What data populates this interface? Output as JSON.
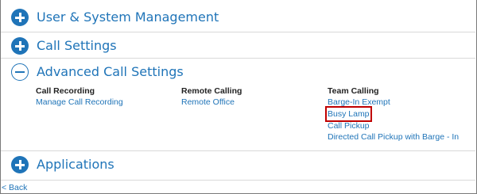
{
  "sections": {
    "user_system": {
      "title": "User & System Management"
    },
    "call_settings": {
      "title": "Call Settings"
    },
    "advanced": {
      "title": "Advanced Call Settings",
      "columns": [
        {
          "heading": "Call Recording",
          "links": [
            "Manage Call Recording"
          ]
        },
        {
          "heading": "Remote Calling",
          "links": [
            "Remote Office"
          ]
        },
        {
          "heading": "Team Calling",
          "links": [
            "Barge-In Exempt",
            "Busy Lamp",
            "Call Pickup",
            "Directed Call Pickup with Barge - In"
          ]
        }
      ]
    },
    "applications": {
      "title": "Applications"
    }
  },
  "footer": {
    "back_label": "< Back"
  },
  "colors": {
    "accent": "#1f74b8",
    "highlight": "#c00000"
  },
  "icons": {
    "expand": "plus-circle-icon",
    "collapse": "minus-circle-icon"
  }
}
